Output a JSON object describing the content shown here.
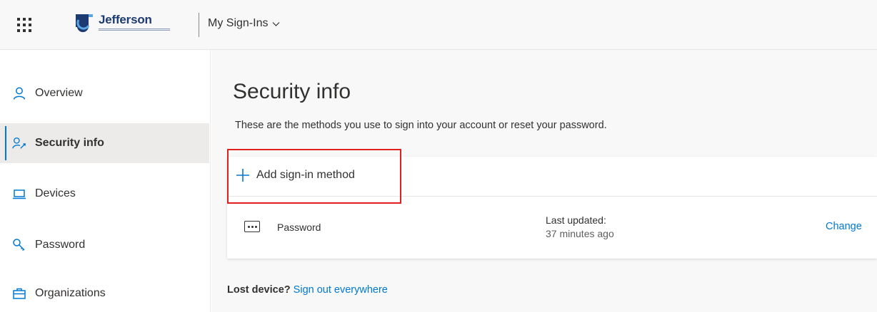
{
  "header": {
    "logo_text": "Jefferson",
    "app_title": "My Sign-Ins"
  },
  "sidebar": {
    "items": [
      {
        "label": "Overview",
        "icon": "person-icon",
        "active": false
      },
      {
        "label": "Security info",
        "icon": "security-person-icon",
        "active": true
      },
      {
        "label": "Devices",
        "icon": "laptop-icon",
        "active": false
      },
      {
        "label": "Password",
        "icon": "key-icon",
        "active": false
      },
      {
        "label": "Organizations",
        "icon": "briefcase-icon",
        "active": false
      }
    ]
  },
  "main": {
    "title": "Security info",
    "description": "These are the methods you use to sign into your account or reset your password.",
    "add_method_label": "Add sign-in method",
    "methods": [
      {
        "icon": "password-dots-icon",
        "name": "Password",
        "updated_label": "Last updated:",
        "updated_value": "37 minutes ago",
        "action_label": "Change"
      }
    ],
    "lost_device_label": "Lost device?",
    "sign_out_link": "Sign out everywhere"
  },
  "colors": {
    "accent": "#0078d4",
    "highlight": "#e02020",
    "brand": "#1d3a72"
  }
}
